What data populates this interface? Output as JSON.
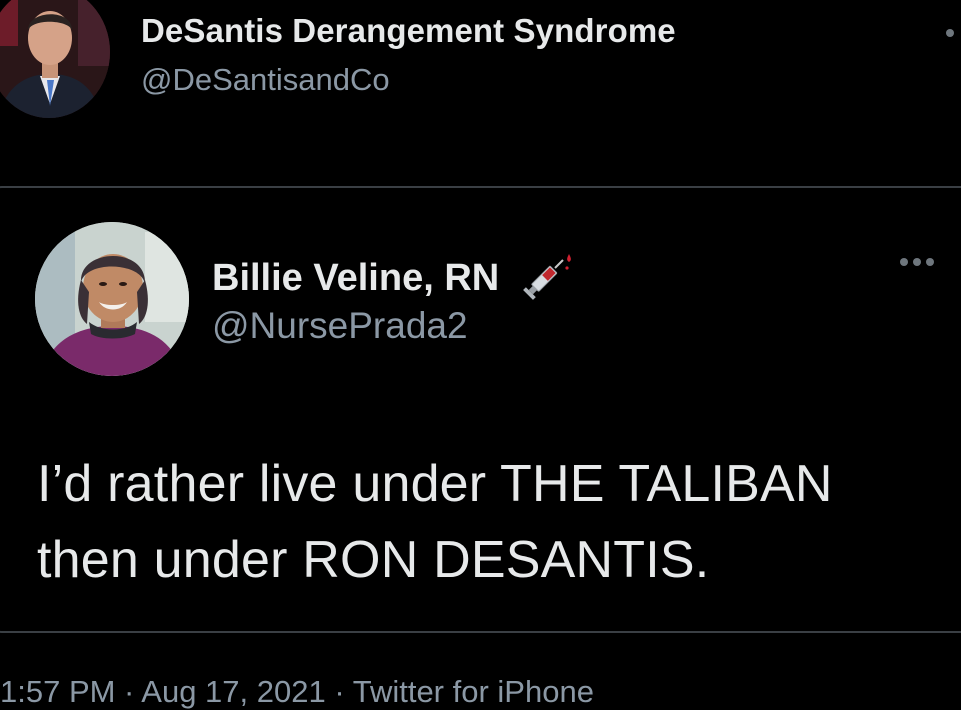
{
  "outer_tweet": {
    "display_name": "DeSantis Derangement Syndrome",
    "handle": "@DeSantisandCo",
    "avatar_icon": "profile-photo-man-in-suit",
    "more_icon": "more-options-dot"
  },
  "quoted_tweet": {
    "display_name": "Billie Veline, RN",
    "name_emoji": "syringe-icon",
    "handle": "@NursePrada2",
    "avatar_icon": "profile-photo-smiling-woman",
    "more_icon": "more-options-ellipsis",
    "text_line_1": "I’d rather live under THE TALIBAN",
    "text_line_2": "then under RON DESANTIS."
  },
  "footer": {
    "meta": "1:57 PM · Aug 17, 2021 · Twitter for iPhone"
  },
  "colors": {
    "background": "#000000",
    "primary_text": "#e7e9ea",
    "secondary_text": "#8b98a5",
    "card_border": "#3a3f44"
  }
}
